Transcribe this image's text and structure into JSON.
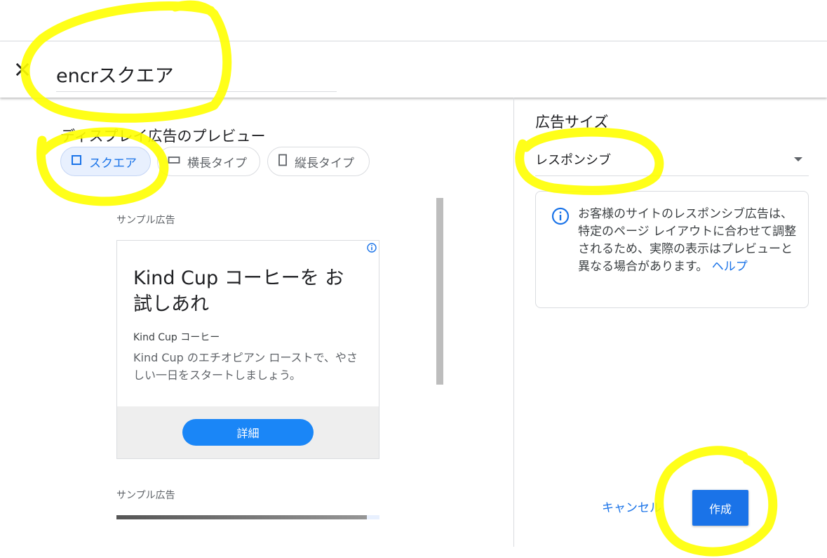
{
  "header": {
    "campaign_name": "encrスクエア"
  },
  "preview": {
    "title": "ディスプレイ広告のプレビュー",
    "chips": [
      {
        "label": "スクエア"
      },
      {
        "label": "横長タイプ"
      },
      {
        "label": "縦長タイプ"
      }
    ],
    "sample_label": "サンプル広告",
    "ad": {
      "headline": "Kind Cup コーヒーを お試しあれ",
      "business": "Kind Cup コーヒー",
      "description": "Kind Cup のエチオピアン ローストで、やさしい一日をスタートしましょう。",
      "cta": "詳細"
    },
    "sample_label_2": "サンプル広告"
  },
  "settings": {
    "size_title": "広告サイズ",
    "size_value": "レスポンシブ",
    "info_text": "お客様のサイトのレスポンシブ広告は、特定のページ レイアウトに合わせて調整されるため、実際の表示はプレビューと異なる場合があります。",
    "help_link": "ヘルプ"
  },
  "actions": {
    "cancel": "キャンセル",
    "create": "作成"
  },
  "colors": {
    "accent": "#1a73e8",
    "cta": "#1a86f7",
    "highlight": "#ffff00"
  }
}
